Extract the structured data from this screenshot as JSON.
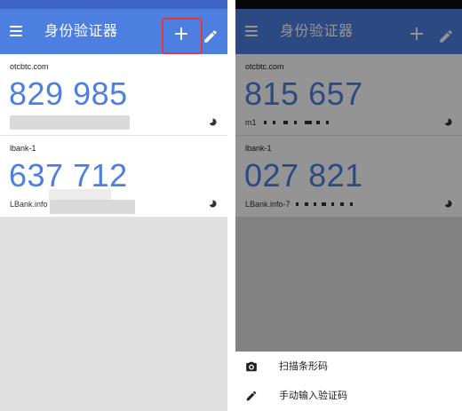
{
  "app": {
    "title": "身份验证器",
    "add_glyph": "+",
    "accent_color": "#4d7fe0",
    "icons": [
      "menu-icon",
      "add-icon",
      "edit-icon",
      "timer-icon",
      "camera-icon",
      "pencil-icon"
    ]
  },
  "left_screen": {
    "accounts": [
      {
        "name": "otcbtc.com",
        "code": "829 985",
        "issuer": ""
      },
      {
        "name": "lbank-1",
        "code": "637 712",
        "issuer": "LBank.info"
      }
    ]
  },
  "right_screen": {
    "accounts": [
      {
        "name": "otcbtc.com",
        "code": "815 657",
        "issuer": "m1"
      },
      {
        "name": "lbank-1",
        "code": "027 821",
        "issuer": "LBank.info-7"
      }
    ],
    "sheet": {
      "scan_label": "扫描条形码",
      "manual_label": "手动输入验证码"
    }
  }
}
